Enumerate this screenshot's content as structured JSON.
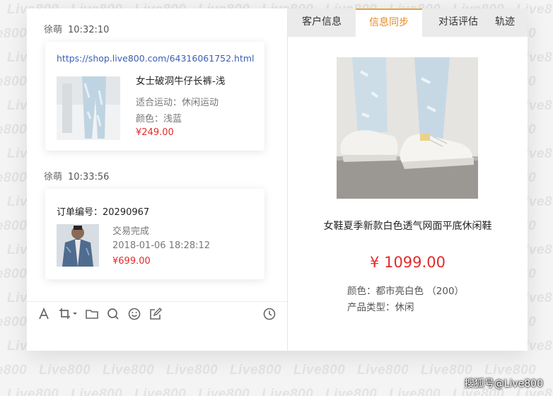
{
  "watermark": {
    "text": "Live800"
  },
  "chat": {
    "messages": [
      {
        "sender": "徐萌",
        "time": "10:32:10",
        "card": {
          "url": "https://shop.live800.com/64316061752.html",
          "title": "女士破洞牛仔长裤-浅",
          "attr1": "适合运动：休闲运动",
          "attr2": "颜色：浅蓝",
          "price": "¥249.00"
        }
      },
      {
        "sender": "徐萌",
        "time": "10:33:56",
        "card": {
          "order_no": "订单编号：20290967",
          "status": "交易完成",
          "datetime": "2018-01-06  18:28:12",
          "price": "¥699.00"
        }
      }
    ]
  },
  "toolbar": {
    "icons": [
      "font-icon",
      "crop-icon",
      "folder-icon",
      "search-icon",
      "emoji-icon",
      "edit-icon",
      "history-icon"
    ]
  },
  "tabs": [
    {
      "label": "客户信息",
      "active": false
    },
    {
      "label": "信息同步",
      "active": true
    },
    {
      "label": "对话评估",
      "active": false
    },
    {
      "label": "轨迹",
      "active": false
    }
  ],
  "product": {
    "title": "女鞋夏季新款白色透气网面平底休闲鞋",
    "price": "¥ 1099.00",
    "color": "颜色：都市亮白色 （200）",
    "type": "产品类型：休闲"
  },
  "footer": {
    "credit": "搜狐号@Live800"
  },
  "colors": {
    "accent": "#e8891c",
    "price": "#e22b2b",
    "link": "#3a5fb5"
  }
}
